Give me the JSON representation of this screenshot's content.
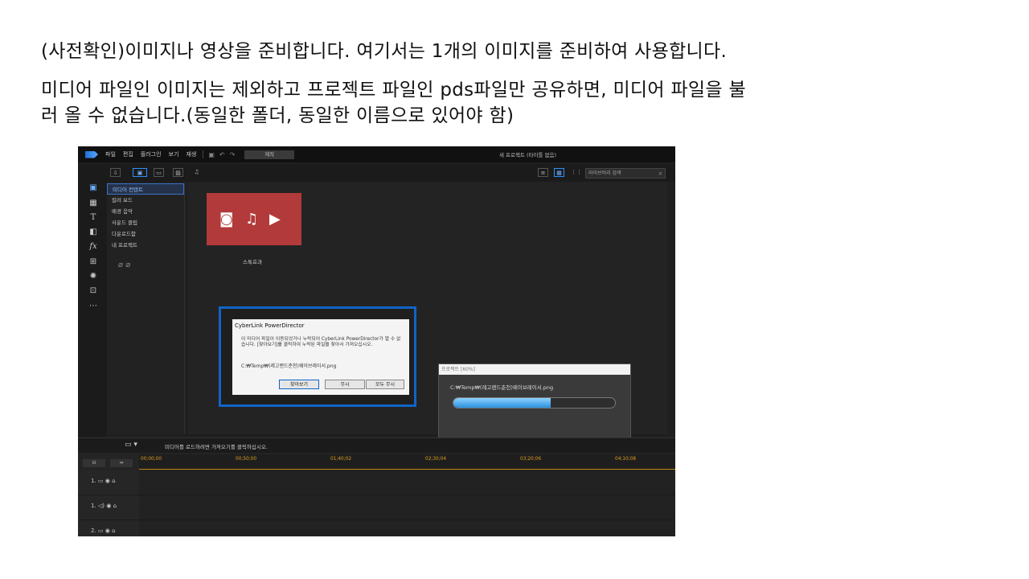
{
  "captions": {
    "line1": "(사전확인)이미지나 영상을 준비합니다. 여기서는 1개의 이미지를 준비하여 사용합니다.",
    "line2": "미디어 파일인 이미지는 제외하고 프로젝트 파일인 pds파일만 공유하면, 미디어 파일을 불",
    "line3": "러 올 수 없습니다.(동일한 폴더, 동일한 이름으로 있어야 함)"
  },
  "app": {
    "menu": [
      "파일",
      "편집",
      "플러그인",
      "보기",
      "재생"
    ],
    "produce_label": "제작",
    "window_title": "새 프로젝트 (타이틀 없음)",
    "search_placeholder": "라이브러리 검색",
    "tree_items": [
      "미디어 컨텐트",
      "컬러 보드",
      "배경 음악",
      "사운드 클립",
      "다운로드함",
      "내 프로젝트"
    ],
    "tile_label": "스톡효과",
    "dialog": {
      "title": "CyberLink PowerDirector",
      "message": "이 미디어 파일이 이동되었거나 누락되어 CyberLink PowerDirector가 열 수 없습니다. [찾아보기]를 클릭하여 누락된 파일을 찾아서 가져오십시오.",
      "path": "C:₩Temp₩(레고랜드춘천)웨이브레이서.png",
      "btn_browse": "찾아보기",
      "btn_ignore": "무시",
      "btn_ignore_all": "모두 무시"
    },
    "progress": {
      "title": "프로젝트 [60%]",
      "path": "C:₩Temp₩(레고랜드춘천)웨이브레이서.png",
      "value": 0.6
    },
    "status_text": "미디어를 로드하려면 가져오기를 클릭하십시오.",
    "ruler_ticks": [
      "00;00;00",
      "00;50;00",
      "01;40;02",
      "02;30;04",
      "03;20;06",
      "04;10;08"
    ],
    "tracks": [
      "1.",
      "1.",
      "2."
    ]
  }
}
